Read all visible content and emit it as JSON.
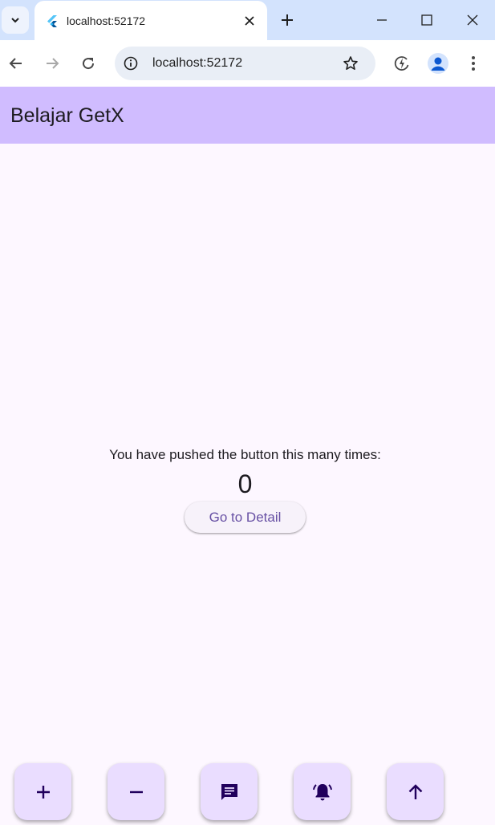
{
  "browser": {
    "tab_title": "localhost:52172",
    "url": "localhost:52172",
    "icons": {
      "tab_search": "chevron-down-icon",
      "favicon": "flutter-icon",
      "tab_close": "close-icon",
      "new_tab": "plus-icon",
      "minimize": "minimize-icon",
      "maximize": "maximize-icon",
      "close_window": "close-icon",
      "back": "arrow-left-icon",
      "forward": "arrow-right-icon",
      "reload": "reload-icon",
      "site_info": "info-icon",
      "bookmark": "star-icon",
      "extension": "performance-icon",
      "profile": "avatar-icon",
      "menu": "kebab-menu-icon"
    }
  },
  "app": {
    "title": "Belajar GetX",
    "counter_label": "You have pushed the button this many times:",
    "counter_value": "0",
    "detail_button_label": "Go to Detail",
    "fabs": [
      {
        "icon": "plus-icon"
      },
      {
        "icon": "minus-icon"
      },
      {
        "icon": "message-icon"
      },
      {
        "icon": "notification-bell-icon"
      },
      {
        "icon": "arrow-up-icon"
      }
    ],
    "colors": {
      "app_bar": "#d0bcff",
      "background": "#fdf7ff",
      "fab": "#eaddff",
      "fab_icon": "#21005d",
      "button_text": "#6750a4"
    }
  }
}
